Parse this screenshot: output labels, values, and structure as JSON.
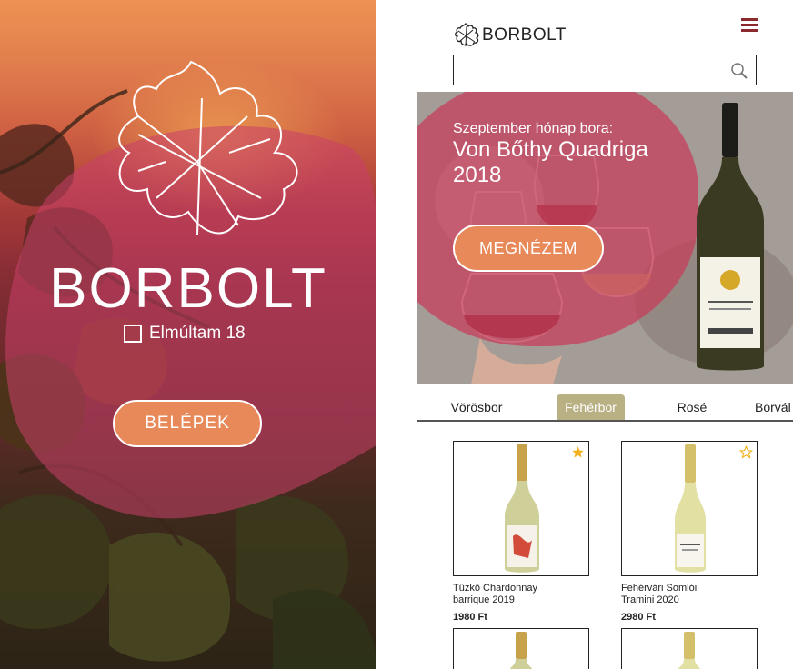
{
  "splash": {
    "brand": "BORBOLT",
    "age_label": "Elmúltam 18",
    "age_checked": false,
    "enter_button": "BELÉPEK"
  },
  "app": {
    "logo_text": "BORBOLT",
    "search": {
      "value": "",
      "placeholder": ""
    },
    "hero": {
      "subtitle": "Szeptember hónap bora:",
      "title": "Von Bőthy Quadriga 2018",
      "button": "MEGNÉZEM"
    },
    "tabs": [
      {
        "label": "Vörösbor",
        "active": false
      },
      {
        "label": "Fehérbor",
        "active": true
      },
      {
        "label": "Rosé",
        "active": false
      },
      {
        "label": "Borvál",
        "active": false
      }
    ],
    "products": [
      {
        "name_line1": "Tűzkő Chardonnay",
        "name_line2": "barrique 2019",
        "price": "1980 Ft",
        "favorite": true,
        "star_icon": "star-filled-icon"
      },
      {
        "name_line1": "Fehérvári Somlói",
        "name_line2": "Tramini 2020",
        "price": "2980 Ft",
        "favorite": false,
        "star_icon": "star-outline-icon"
      }
    ]
  },
  "colors": {
    "accent_orange": "#e8895a",
    "brand_wine": "#8b2a2e",
    "active_tab": "#b9b084",
    "star_gold": "#f2b01e"
  }
}
